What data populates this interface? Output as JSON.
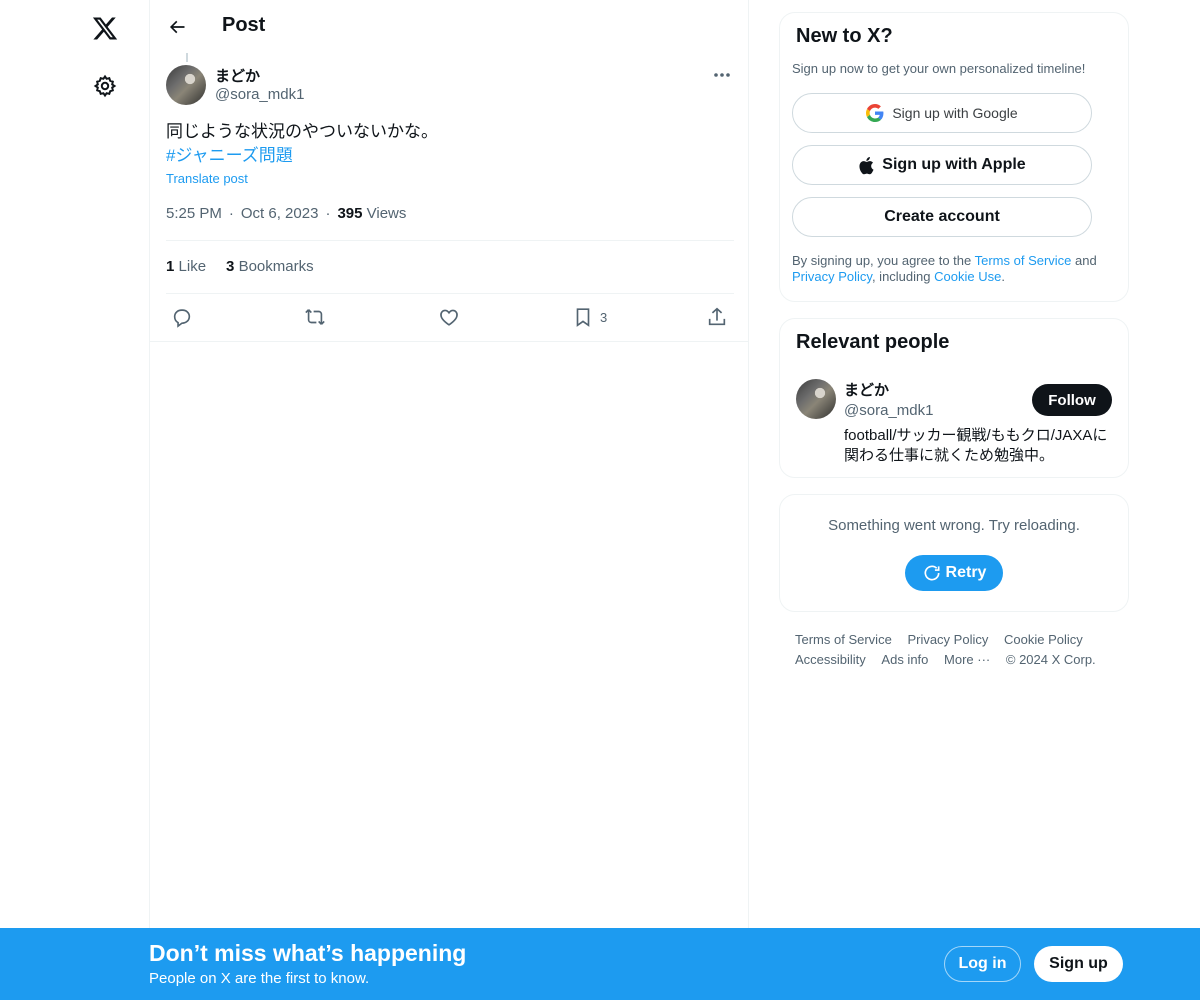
{
  "nav": {
    "logo_icon": "x-logo-icon",
    "settings_icon": "gear-icon"
  },
  "header": {
    "title": "Post",
    "back_icon": "arrow-left-icon"
  },
  "post": {
    "author_name": "まどか",
    "author_handle": "@sora_mdk1",
    "text": "同じような状況のやついないかな。",
    "hashtag": "#ジャニーズ問題",
    "translate_label": "Translate post",
    "time": "5:25 PM",
    "date": "Oct 6, 2023",
    "views_count": "395",
    "views_label": "Views",
    "likes_count": "1",
    "likes_label": "Like",
    "bookmarks_count": "3",
    "bookmarks_label": "Bookmarks",
    "bookmark_action_count": "3"
  },
  "sidebar": {
    "newto": {
      "title": "New to X?",
      "subtitle": "Sign up now to get your own personalized timeline!",
      "google_label": "Sign up with Google",
      "apple_label": "Sign up with Apple",
      "create_label": "Create account",
      "legal_prefix": "By signing up, you agree to the ",
      "terms_link": "Terms of Service",
      "legal_and": " and ",
      "privacy_link": "Privacy Policy",
      "legal_including": ", including ",
      "cookie_link": "Cookie Use",
      "legal_suffix": "."
    },
    "people": {
      "title": "Relevant people",
      "name": "まどか",
      "handle": "@sora_mdk1",
      "follow_label": "Follow",
      "bio": "football/サッカー観戦/ももクロ/JAXAに関わる仕事に就くため勉強中。"
    },
    "error": {
      "text": "Something went wrong. Try reloading.",
      "retry_label": "Retry"
    },
    "footer": {
      "terms": "Terms of Service",
      "privacy": "Privacy Policy",
      "cookie": "Cookie Policy",
      "accessibility": "Accessibility",
      "ads": "Ads info",
      "more": "More ···",
      "copyright": "© 2024 X Corp."
    }
  },
  "banner": {
    "title": "Don’t miss what’s happening",
    "subtitle": "People on X are the first to know.",
    "login_label": "Log in",
    "signup_label": "Sign up"
  },
  "colors": {
    "accent": "#1d9bf0",
    "text": "#0f1419",
    "secondary": "#536471",
    "border": "#eff3f4"
  }
}
